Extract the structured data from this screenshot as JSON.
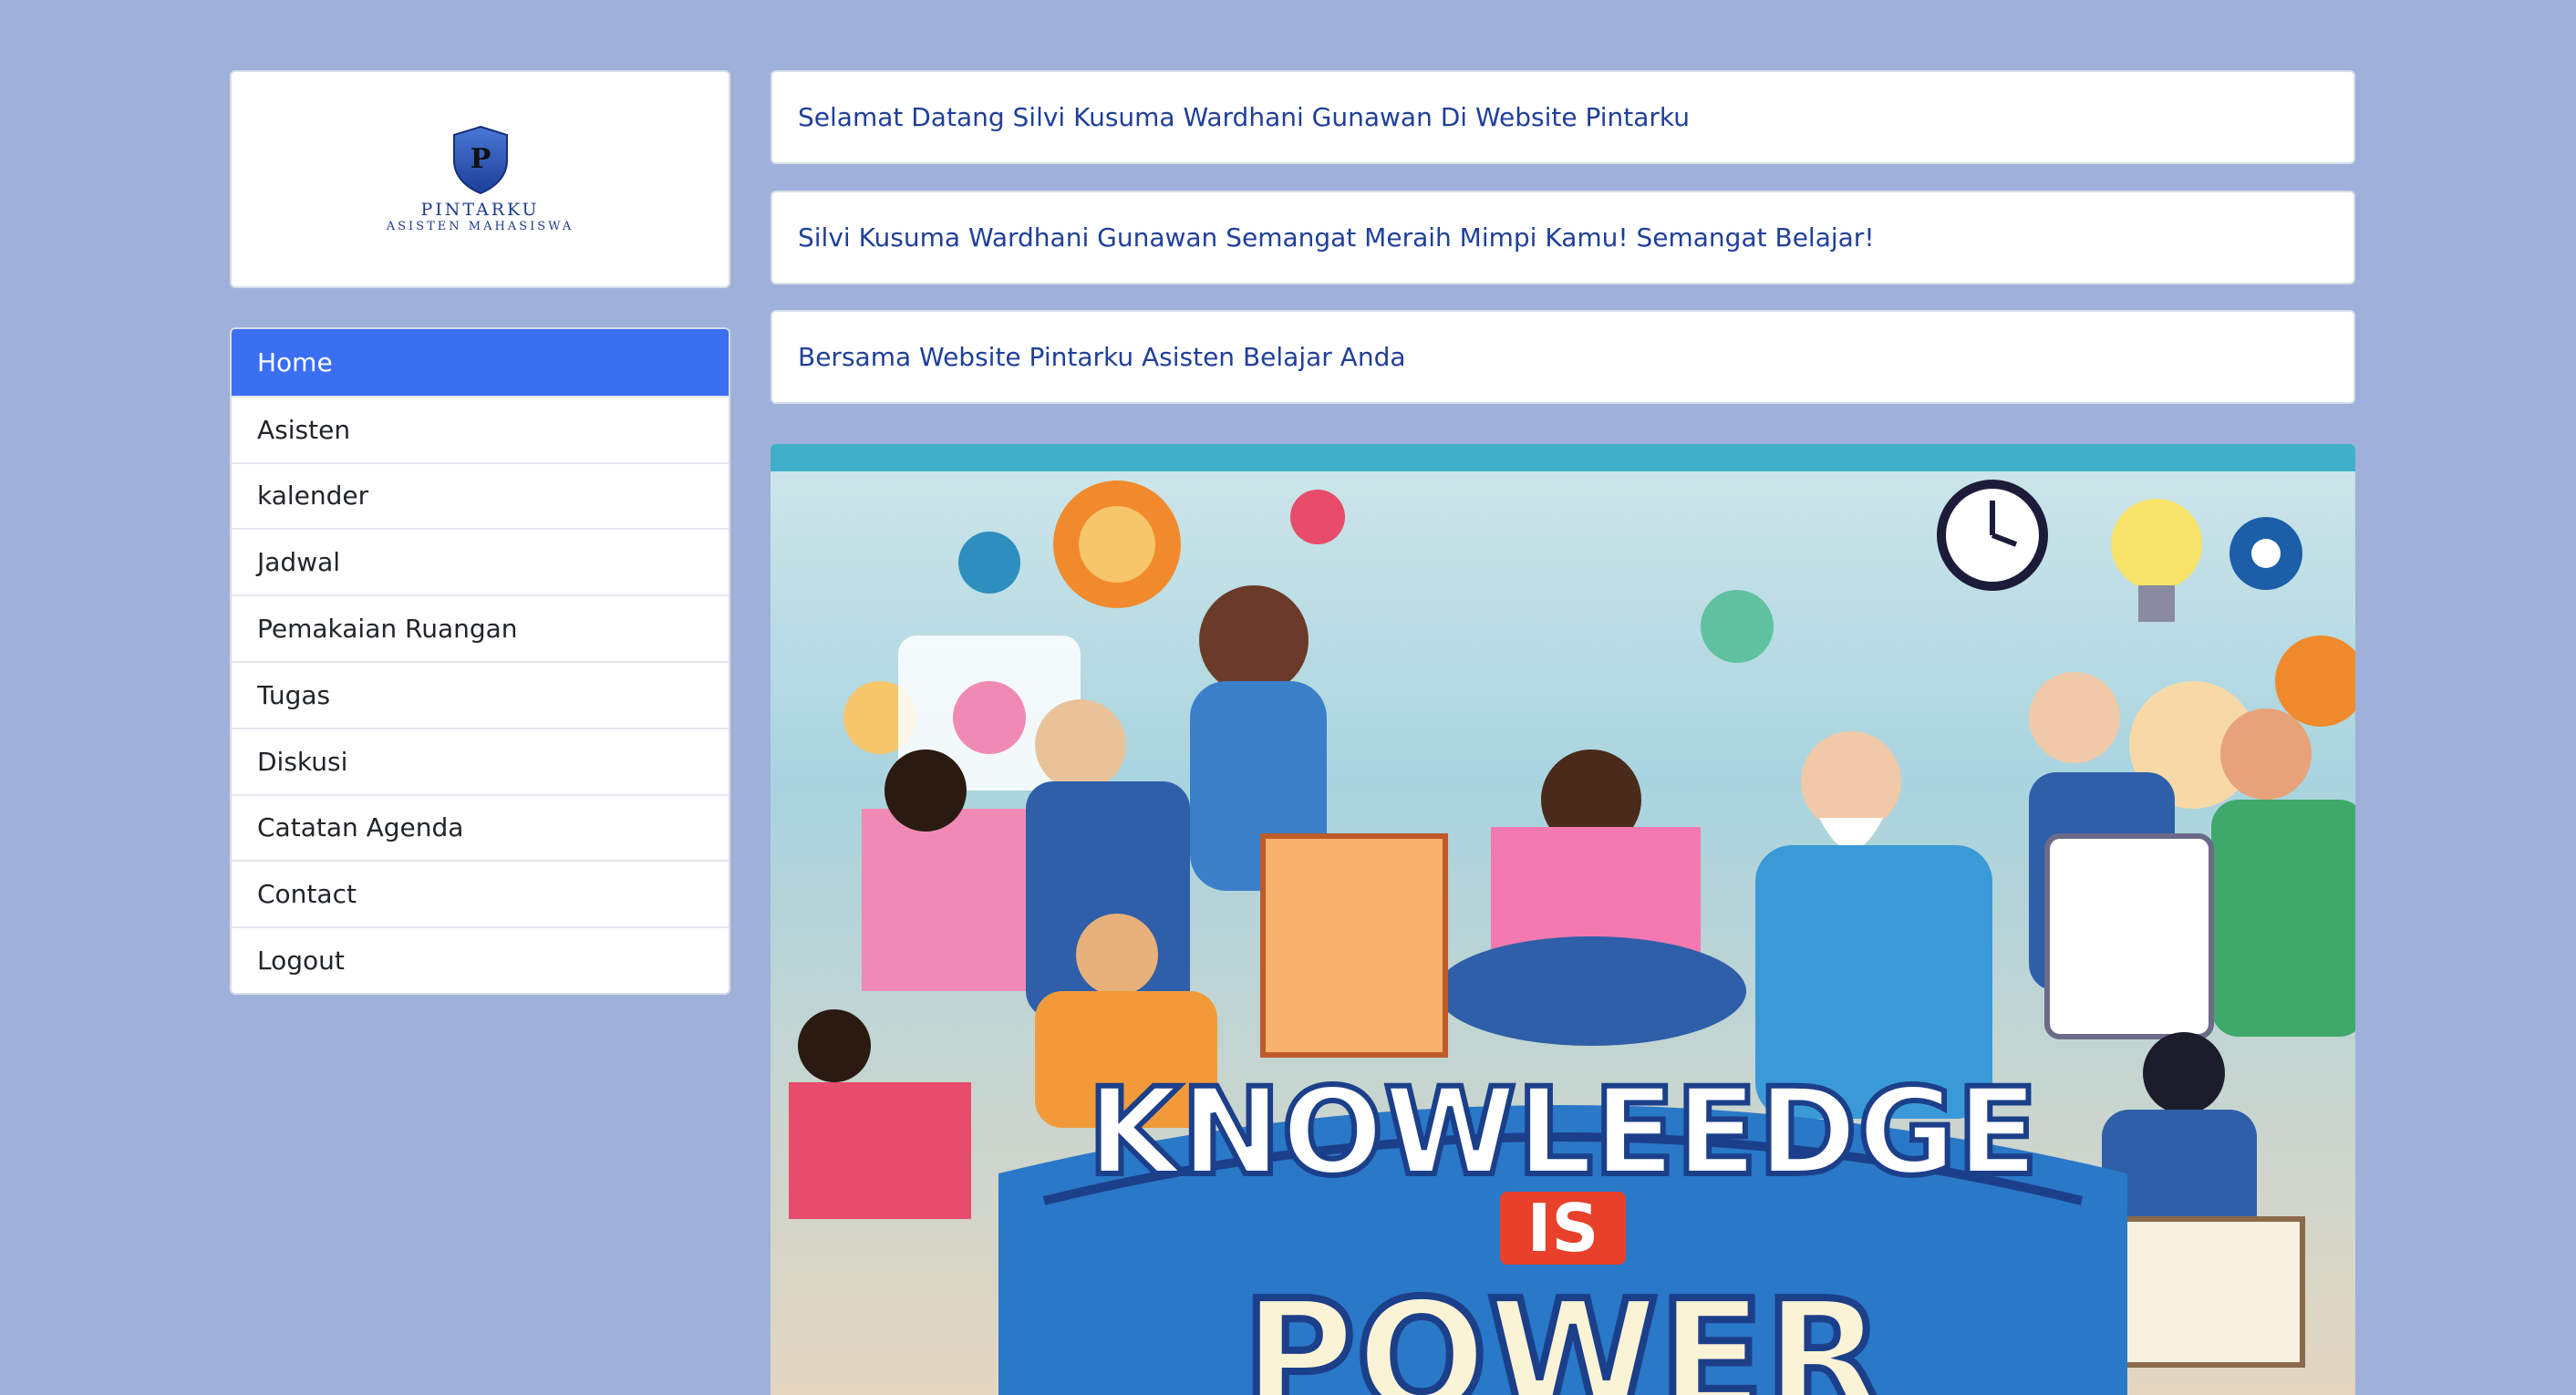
{
  "brand": {
    "logo_letter": "P",
    "name": "PINTARKU",
    "tagline": "ASISTEN MAHASISWA"
  },
  "nav": {
    "items": [
      {
        "label": "Home",
        "active": true
      },
      {
        "label": "Asisten",
        "active": false
      },
      {
        "label": "kalender",
        "active": false
      },
      {
        "label": "Jadwal",
        "active": false
      },
      {
        "label": "Pemakaian Ruangan",
        "active": false
      },
      {
        "label": "Tugas",
        "active": false
      },
      {
        "label": "Diskusi",
        "active": false
      },
      {
        "label": "Catatan Agenda",
        "active": false
      },
      {
        "label": "Contact",
        "active": false
      },
      {
        "label": "Logout",
        "active": false
      }
    ]
  },
  "messages": {
    "welcome": "Selamat Datang Silvi Kusuma Wardhani Gunawan Di Website Pintarku",
    "motivation": "Silvi Kusuma Wardhani Gunawan Semangat Meraih Mimpi Kamu! Semangat Belajar!",
    "together": "Bersama Website Pintarku Asisten Belajar Anda"
  },
  "hero": {
    "banner_line1": "KNOWLEEDGE",
    "banner_line2": "IS",
    "banner_line3": "POWER"
  },
  "colors": {
    "page_bg": "#9fb1da",
    "accent": "#3a6ff2",
    "message_text": "#1f3f9a"
  }
}
